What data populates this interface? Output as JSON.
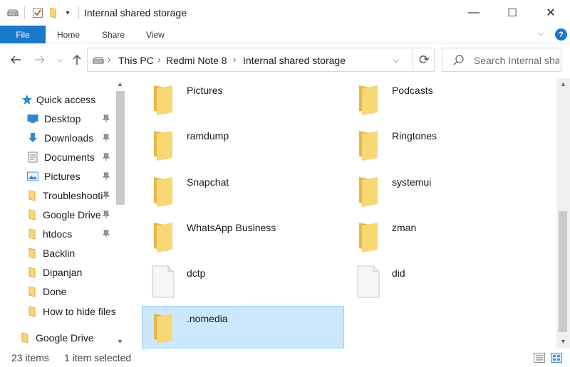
{
  "window": {
    "title": "Internal shared storage",
    "controls": {
      "minimize": "—",
      "maximize": "☐",
      "close": "✕"
    }
  },
  "ribbon": {
    "tabs": [
      "File",
      "Home",
      "Share",
      "View"
    ],
    "help": "?"
  },
  "address": {
    "crumbs": [
      "This PC",
      "Redmi Note 8",
      "Internal shared storage"
    ],
    "separator": "›"
  },
  "search": {
    "placeholder": "Search Internal sha..."
  },
  "nav_pane": {
    "quick_access": "Quick access",
    "items": [
      {
        "label": "Desktop",
        "icon": "desktop-icon",
        "pinned": true
      },
      {
        "label": "Downloads",
        "icon": "downloads-icon",
        "pinned": true
      },
      {
        "label": "Documents",
        "icon": "documents-icon",
        "pinned": true
      },
      {
        "label": "Pictures",
        "icon": "pictures-icon",
        "pinned": true
      },
      {
        "label": "Troubleshooti",
        "icon": "folder-icon",
        "pinned": true
      },
      {
        "label": "Google Drive",
        "icon": "folder-icon",
        "pinned": true
      },
      {
        "label": "htdocs",
        "icon": "folder-icon",
        "pinned": true
      },
      {
        "label": "Backlin",
        "icon": "folder-icon",
        "pinned": false
      },
      {
        "label": "Dipanjan",
        "icon": "folder-icon",
        "pinned": false
      },
      {
        "label": "Done",
        "icon": "folder-icon",
        "pinned": false
      },
      {
        "label": "How to hide files",
        "icon": "folder-icon",
        "pinned": false
      }
    ],
    "google_drive": "Google Drive"
  },
  "files": [
    {
      "name": "Pictures",
      "type": "folder",
      "selected": false
    },
    {
      "name": "Podcasts",
      "type": "folder",
      "selected": false
    },
    {
      "name": "ramdump",
      "type": "folder",
      "selected": false
    },
    {
      "name": "Ringtones",
      "type": "folder",
      "selected": false
    },
    {
      "name": "Snapchat",
      "type": "folder",
      "selected": false
    },
    {
      "name": "systemui",
      "type": "folder",
      "selected": false
    },
    {
      "name": "WhatsApp Business",
      "type": "folder",
      "selected": false
    },
    {
      "name": "zman",
      "type": "folder",
      "selected": false
    },
    {
      "name": "dctp",
      "type": "file",
      "selected": false
    },
    {
      "name": "did",
      "type": "file",
      "selected": false
    },
    {
      "name": ".nomedia",
      "type": "folder",
      "selected": true
    }
  ],
  "status": {
    "item_count": "23 items",
    "selection": "1 item selected"
  },
  "colors": {
    "accent": "#1979ca",
    "folder": "#f8d775",
    "selection_bg": "#cce8ff",
    "selection_border": "#99d1ff"
  }
}
